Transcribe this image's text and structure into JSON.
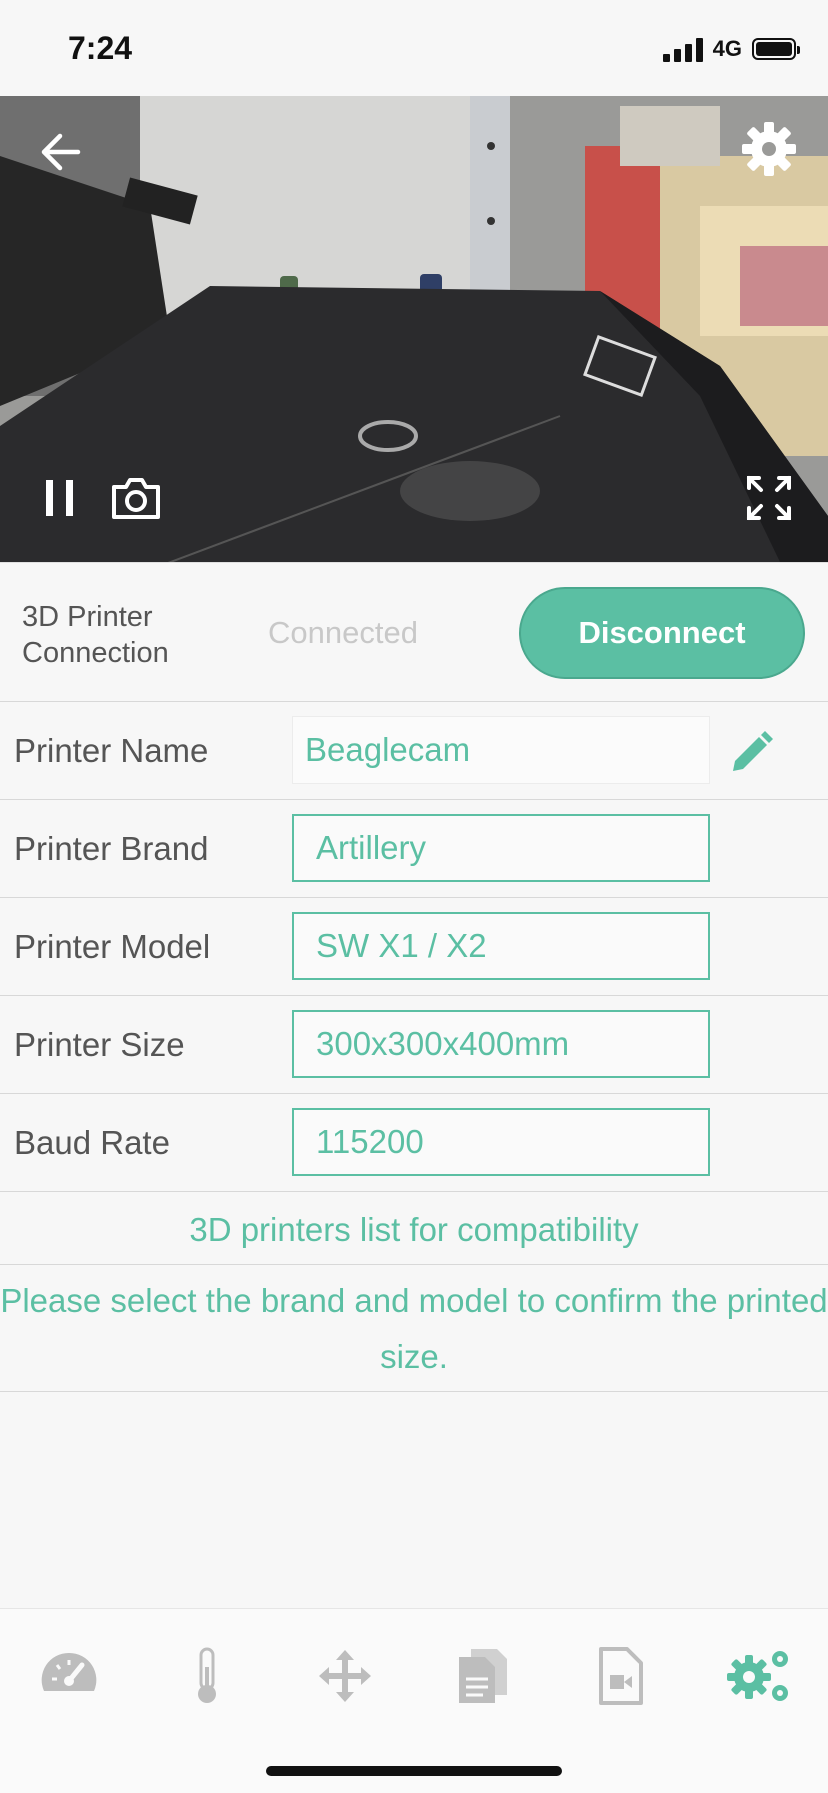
{
  "status_bar": {
    "time": "7:24",
    "network": "4G"
  },
  "camera": {
    "back_icon": "arrow-left-icon",
    "settings_icon": "gear-icon",
    "pause_icon": "pause-icon",
    "snapshot_icon": "camera-icon",
    "fullscreen_icon": "expand-icon"
  },
  "connection": {
    "label": "3D Printer Connection",
    "status": "Connected",
    "button_label": "Disconnect"
  },
  "fields": [
    {
      "label": "Printer Name",
      "value": "Beaglecam"
    },
    {
      "label": "Printer Brand",
      "value": "Artillery"
    },
    {
      "label": "Printer Model",
      "value": "SW X1 / X2"
    },
    {
      "label": "Printer Size",
      "value": "300x300x400mm"
    },
    {
      "label": "Baud Rate",
      "value": "115200"
    }
  ],
  "compat_link": "3D printers list for compatibility",
  "hint": "Please select the brand and model to confirm the printed size.",
  "tabs": [
    {
      "icon": "dashboard-gauge-icon",
      "active": false
    },
    {
      "icon": "thermometer-icon",
      "active": false
    },
    {
      "icon": "move-arrows-icon",
      "active": false
    },
    {
      "icon": "files-icon",
      "active": false
    },
    {
      "icon": "video-file-icon",
      "active": false
    },
    {
      "icon": "settings-gears-icon",
      "active": true
    }
  ],
  "colors": {
    "accent": "#5bbfa3",
    "inactive_icon": "#bdbdbd",
    "background": "#f7f7f7"
  }
}
